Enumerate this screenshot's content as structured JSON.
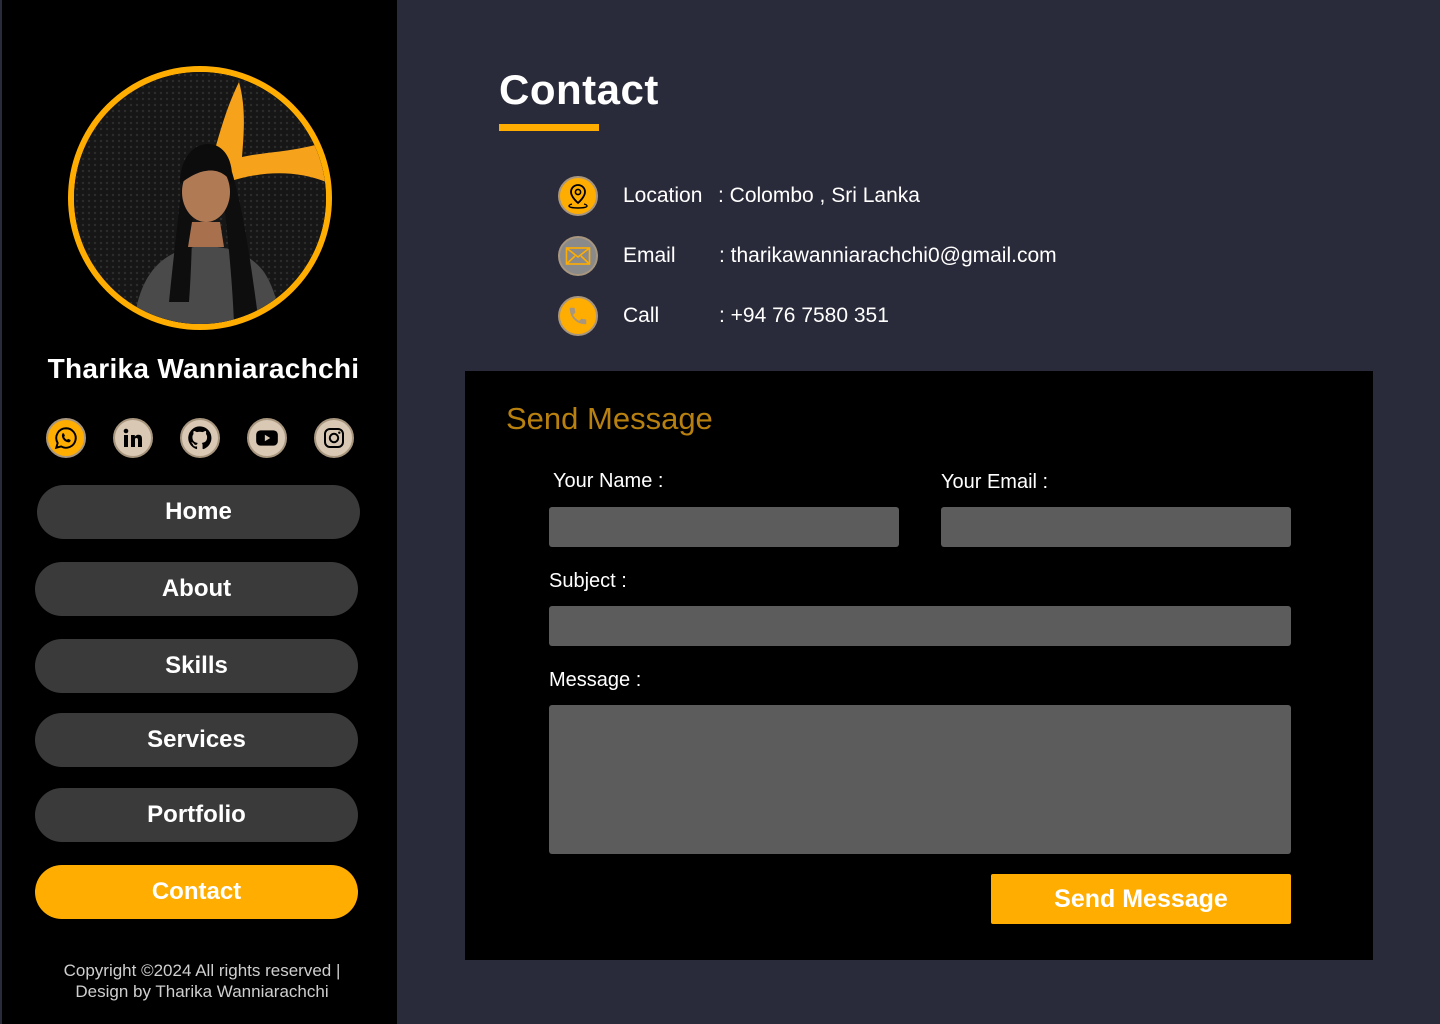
{
  "sidebar": {
    "name": "Tharika Wanniarachchi",
    "socials": [
      {
        "icon": "whatsapp-icon"
      },
      {
        "icon": "linkedin-icon"
      },
      {
        "icon": "github-icon"
      },
      {
        "icon": "youtube-icon"
      },
      {
        "icon": "instagram-icon"
      }
    ],
    "nav": [
      "Home",
      "About",
      "Skills",
      "Services",
      "Portfolio",
      "Contact"
    ],
    "active_nav": "Contact",
    "copyright_line1": "Copyright ©2024 All rights reserved |",
    "copyright_line2": "Design by Tharika Wanniarachchi"
  },
  "main": {
    "title": "Contact",
    "contact_info": [
      {
        "icon": "location-pin-icon",
        "label": "Location",
        "value": ": Colombo , Sri Lanka"
      },
      {
        "icon": "envelope-icon",
        "label": "Email",
        "value": ": tharikawanniarachchi0@gmail.com"
      },
      {
        "icon": "phone-icon",
        "label": "Call",
        "value": ": +94 76 7580 351"
      }
    ]
  },
  "form": {
    "title": "Send Message",
    "name_label": "Your Name :",
    "name_value": "",
    "email_label": "Your Email :",
    "email_value": "",
    "subject_label": "Subject :",
    "subject_value": "",
    "message_label": "Message :",
    "message_value": "",
    "submit_label": "Send Message"
  },
  "colors": {
    "accent": "#ffad00",
    "sidebar_bg": "#000000",
    "main_bg": "#2a2b3a",
    "nav_button": "#3a3a3a",
    "input_bg": "#5c5c5c",
    "form_title": "#b8800e"
  }
}
